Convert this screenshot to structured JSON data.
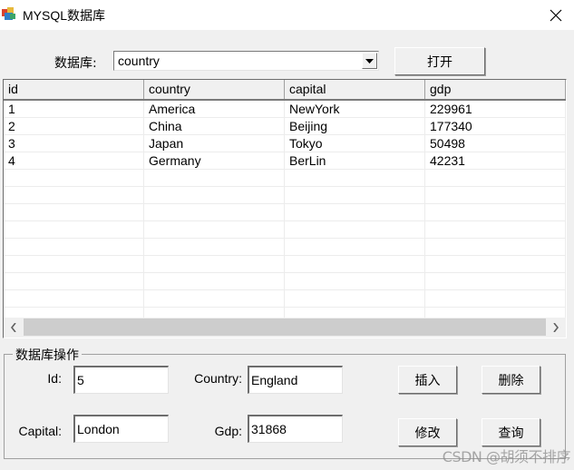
{
  "window": {
    "title": "MYSQL数据库",
    "icon": "mysql-app-icon",
    "close_icon": "close-icon"
  },
  "toolbar": {
    "database_label": "数据库:",
    "database_combo_value": "country",
    "open_button_label": "打开"
  },
  "grid": {
    "columns": [
      "id",
      "country",
      "capital",
      "gdp"
    ],
    "rows": [
      [
        "1",
        "America",
        "NewYork",
        "229961"
      ],
      [
        "2",
        "China",
        "Beijing",
        "177340"
      ],
      [
        "3",
        "Japan",
        "Tokyo",
        "50498"
      ],
      [
        "4",
        "Germany",
        "BerLin",
        "42231"
      ]
    ],
    "empty_rows": 12,
    "scroll_left_icon": "chevron-left-icon",
    "scroll_right_icon": "chevron-right-icon"
  },
  "operations": {
    "group_title": "数据库操作",
    "fields": {
      "id": {
        "label": "Id:",
        "value": "5"
      },
      "country": {
        "label": "Country:",
        "value": "England"
      },
      "capital": {
        "label": "Capital:",
        "value": "London"
      },
      "gdp": {
        "label": "Gdp:",
        "value": "31868"
      }
    },
    "buttons": {
      "insert": "插入",
      "delete": "删除",
      "update": "修改",
      "query": "查询"
    }
  },
  "watermark": "CSDN @胡须不排序"
}
